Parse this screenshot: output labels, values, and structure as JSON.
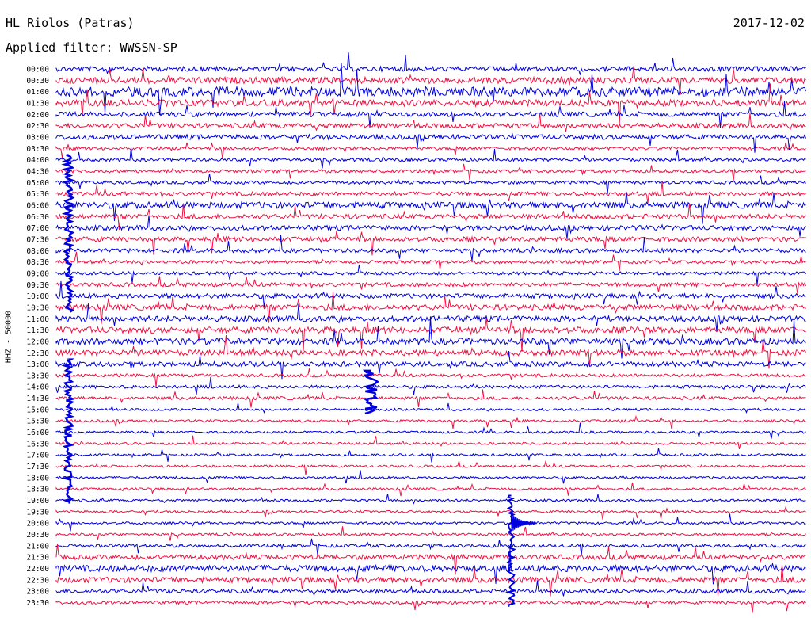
{
  "header": {
    "station": "HL Riolos (Patras)",
    "filter": "Applied filter: WWSSN-SP",
    "date": "2017-12-02"
  },
  "channel_label": "HHZ - 50000",
  "chart_data": {
    "type": "line",
    "subtype": "helicorder",
    "title": "HL Riolos (Patras)",
    "subtitle": "Applied filter: WWSSN-SP",
    "date": "2017-12-02",
    "ylabel": "HHZ - 50000",
    "row_interval_minutes": 30,
    "row_count": 48,
    "row_labels": [
      "00:00",
      "00:30",
      "01:00",
      "01:30",
      "02:00",
      "02:30",
      "03:00",
      "03:30",
      "04:00",
      "04:30",
      "05:00",
      "05:30",
      "06:00",
      "06:30",
      "07:00",
      "07:30",
      "08:00",
      "08:30",
      "09:00",
      "09:30",
      "10:00",
      "10:30",
      "11:00",
      "11:30",
      "12:00",
      "12:30",
      "13:00",
      "13:30",
      "14:00",
      "14:30",
      "15:00",
      "15:30",
      "16:00",
      "16:30",
      "17:00",
      "17:30",
      "18:00",
      "18:30",
      "19:00",
      "19:30",
      "20:00",
      "20:30",
      "21:00",
      "21:30",
      "22:00",
      "22:30",
      "23:00",
      "23:30"
    ],
    "series_colors": [
      "#0000dd",
      "#ee1144"
    ],
    "noise_amplitude_by_row": [
      3,
      4,
      6,
      4,
      3,
      3,
      3,
      2,
      2,
      2,
      2,
      2.5,
      4,
      3,
      3,
      3,
      2.5,
      2,
      2,
      2.5,
      3,
      3.5,
      3.5,
      4,
      4,
      3.5,
      3,
      2,
      2,
      2,
      1.5,
      1.5,
      1.5,
      1.5,
      1.5,
      1.5,
      1.5,
      1.5,
      1.5,
      1.5,
      1.5,
      1.5,
      2,
      3,
      4,
      3.5,
      2.5,
      2
    ],
    "events": [
      {
        "start_time": "04:00",
        "end_time": "10:30",
        "minute_in_row": 0.5,
        "label": "long-duration signal"
      },
      {
        "start_time": "13:00",
        "end_time": "19:00",
        "minute_in_row": 0.5,
        "label": "long-duration signal"
      },
      {
        "start_time": "13:30",
        "end_time": "15:00",
        "minute_in_row": 12.6,
        "label": "burst"
      },
      {
        "start_time": "19:00",
        "end_time": "23:30",
        "minute_in_row": 18.2,
        "label": "earthquake arrival"
      }
    ]
  }
}
